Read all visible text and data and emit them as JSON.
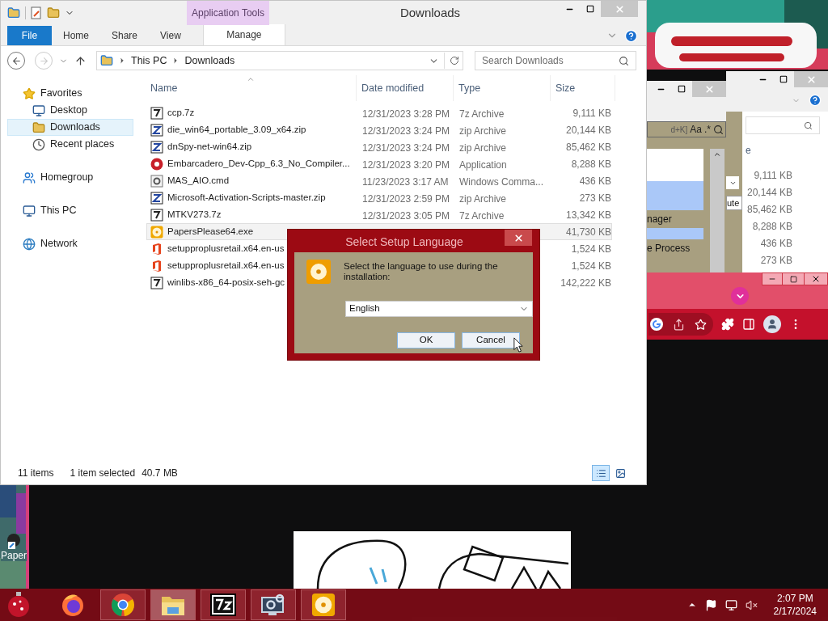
{
  "explorer": {
    "title": "Downloads",
    "contextual_tab": "Application Tools",
    "ribbon_tabs": [
      {
        "label": "File",
        "kind": "file",
        "selected": false
      },
      {
        "label": "Home",
        "kind": "plain",
        "selected": false
      },
      {
        "label": "Share",
        "kind": "plain",
        "selected": false
      },
      {
        "label": "View",
        "kind": "plain",
        "selected": false
      },
      {
        "label": "Manage",
        "kind": "contextual",
        "selected": false
      }
    ],
    "breadcrumb": [
      "This PC",
      "Downloads"
    ],
    "search": {
      "placeholder": "Search Downloads"
    },
    "sidebar": [
      {
        "label": "Favorites",
        "selected": false,
        "children": [
          {
            "label": "Desktop",
            "selected": false
          },
          {
            "label": "Downloads",
            "selected": true
          },
          {
            "label": "Recent places",
            "selected": false
          }
        ]
      },
      {
        "label": "Homegroup",
        "selected": false
      },
      {
        "label": "This PC",
        "selected": false
      },
      {
        "label": "Network",
        "selected": false
      }
    ],
    "columns": [
      "Name",
      "Date modified",
      "Type",
      "Size"
    ],
    "files": [
      {
        "kind": "sevenzip",
        "name": "ccp.7z",
        "date": "12/31/2023 3:28 PM",
        "type": "7z Archive",
        "size": "9,111 KB",
        "selected": false
      },
      {
        "kind": "zip",
        "name": "die_win64_portable_3.09_x64.zip",
        "date": "12/31/2023 3:24 PM",
        "type": "zip Archive",
        "size": "20,144 KB",
        "selected": false
      },
      {
        "kind": "zip",
        "name": "dnSpy-net-win64.zip",
        "date": "12/31/2023 3:24 PM",
        "type": "zip Archive",
        "size": "85,462 KB",
        "selected": false
      },
      {
        "kind": "app",
        "name": "Embarcadero_Dev-Cpp_6.3_No_Compiler...",
        "date": "12/31/2023 3:20 PM",
        "type": "Application",
        "size": "8,288 KB",
        "selected": false
      },
      {
        "kind": "cmd",
        "name": "MAS_AIO.cmd",
        "date": "11/23/2023 3:17 AM",
        "type": "Windows Comma...",
        "size": "436 KB",
        "selected": false
      },
      {
        "kind": "zip",
        "name": "Microsoft-Activation-Scripts-master.zip",
        "date": "12/31/2023 2:59 PM",
        "type": "zip Archive",
        "size": "273 KB",
        "selected": false
      },
      {
        "kind": "sevenzip",
        "name": "MTKV273.7z",
        "date": "12/31/2023 3:05 PM",
        "type": "7z Archive",
        "size": "13,342 KB",
        "selected": false
      },
      {
        "kind": "disc",
        "name": "PapersPlease64.exe",
        "size": "41,730 KB",
        "selected": true
      },
      {
        "kind": "office",
        "name": "setupproplusretail.x64.en-us",
        "size": "1,524 KB",
        "selected": false
      },
      {
        "kind": "office",
        "name": "setupproplusretail.x64.en-us",
        "size": "1,524 KB",
        "selected": false
      },
      {
        "kind": "sevenzip",
        "name": "winlibs-x86_64-posix-seh-gc",
        "size": "142,222 KB",
        "selected": false
      }
    ],
    "status": {
      "count": "11 items",
      "selection": "1 item selected",
      "selection_size": "40.7 MB"
    },
    "views": [
      {
        "selected": true
      },
      {
        "selected": false
      }
    ]
  },
  "dialog": {
    "title": "Select Setup Language",
    "message": "Select the language to use during the installation:",
    "language": "English",
    "buttons": [
      "OK",
      "Cancel"
    ]
  },
  "back_windows": {
    "header": "e",
    "sizes": [
      "9,111 KB",
      "20,144 KB",
      "85,462 KB",
      "8,288 KB",
      "436 KB",
      "273 KB"
    ],
    "field_text": "ute",
    "find_hint": "d+K]",
    "match_case": "Aa",
    "regex": ".*",
    "list_items": [
      "nager",
      "e Process"
    ]
  },
  "desktop": {
    "shortcut_label": "Paper"
  },
  "taskbar": {
    "apps": [
      {
        "kind": "firefox",
        "running": false,
        "active": false
      },
      {
        "kind": "chrome",
        "running": true,
        "active": false
      },
      {
        "kind": "explorer",
        "running": true,
        "active": true
      },
      {
        "kind": "sevenzip",
        "running": true,
        "active": false
      },
      {
        "kind": "settings",
        "running": true,
        "active": false
      },
      {
        "kind": "disc",
        "running": true,
        "active": false
      }
    ],
    "time": "2:07 PM",
    "date": "2/17/2024"
  }
}
